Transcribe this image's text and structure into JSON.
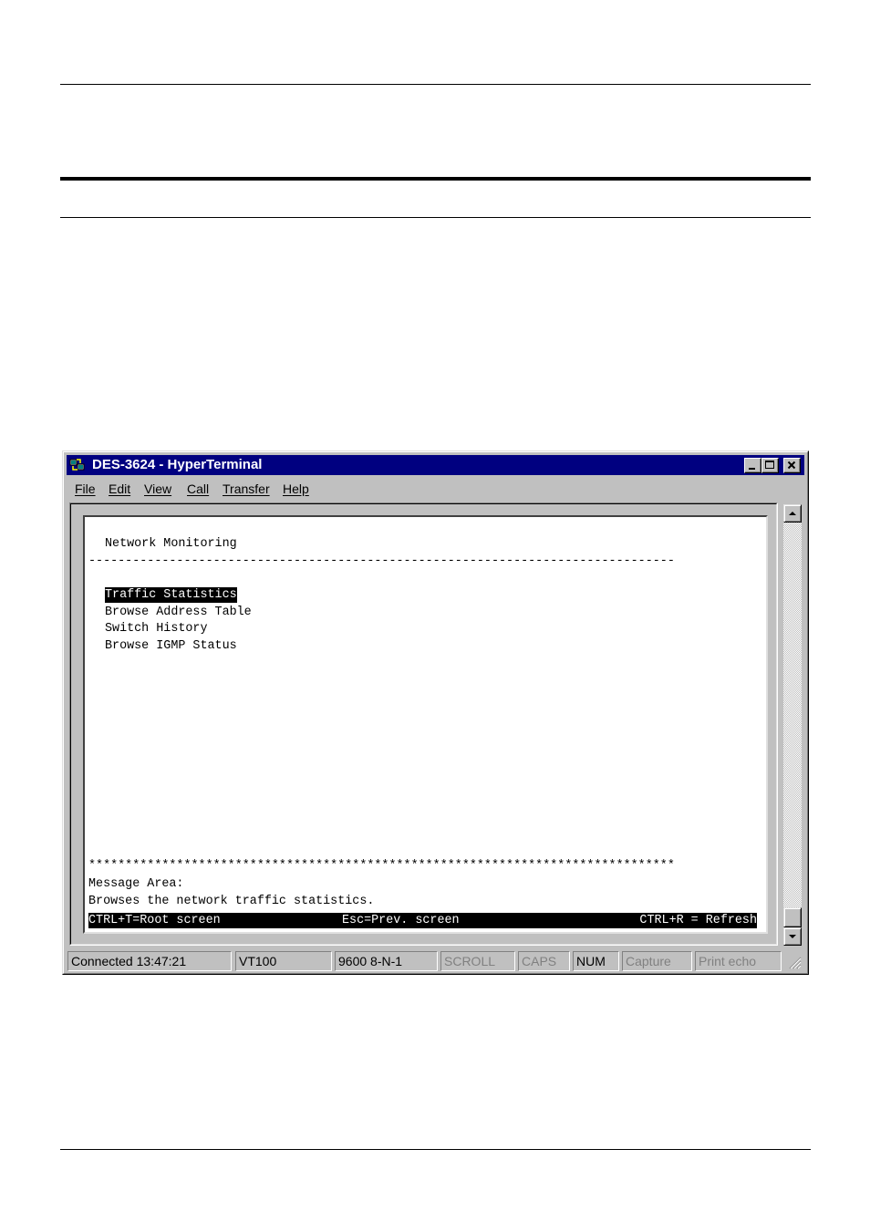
{
  "window": {
    "title": "DES-3624 - HyperTerminal"
  },
  "menu": [
    {
      "label": "File"
    },
    {
      "label": "Edit"
    },
    {
      "label": "View"
    },
    {
      "label": "Call"
    },
    {
      "label": "Transfer"
    },
    {
      "label": "Help"
    }
  ],
  "terminal": {
    "heading": "Network Monitoring",
    "separator": "--------------------------------------------------------------------------------",
    "items": [
      {
        "label": "Traffic Statistics",
        "selected": true
      },
      {
        "label": "Browse Address Table",
        "selected": false
      },
      {
        "label": "Switch History",
        "selected": false
      },
      {
        "label": "Browse IGMP Status",
        "selected": false
      }
    ],
    "stars": "********************************************************************************",
    "message_label": "Message Area:",
    "message_text": "Browses the network traffic statistics.",
    "footer": {
      "root": "CTRL+T=Root screen",
      "prev": "Esc=Prev. screen",
      "refresh": "CTRL+R = Refresh"
    }
  },
  "statusbar": [
    {
      "label": "Connected 13:47:21",
      "active": true
    },
    {
      "label": "VT100",
      "active": true
    },
    {
      "label": "9600 8-N-1",
      "active": true
    },
    {
      "label": "SCROLL",
      "active": false
    },
    {
      "label": "CAPS",
      "active": false
    },
    {
      "label": "NUM",
      "active": true
    },
    {
      "label": "Capture",
      "active": false
    },
    {
      "label": "Print echo",
      "active": false
    }
  ],
  "colors": {
    "titlebar": "#000080",
    "chrome": "#c0c0c0",
    "terminal_bg": "#ffffff",
    "terminal_fg": "#000000"
  }
}
